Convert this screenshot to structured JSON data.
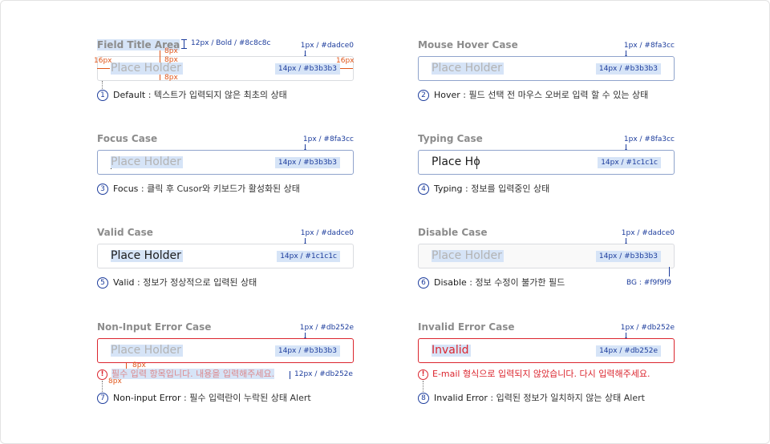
{
  "cases": [
    {
      "id": "default",
      "title": "Field Title Area",
      "value": "Place Holder",
      "spec": "14px / #b3b3b3",
      "border_note": "1px / #dadce0",
      "num": "1",
      "desc_label": "Default",
      "desc_text": " : 텍스트가 입력되지 않은 최초의 상태"
    },
    {
      "id": "hover",
      "title": "Mouse Hover Case",
      "value": "Place Holder",
      "spec": "14px / #b3b3b3",
      "border_note": "1px / #8fa3cc",
      "num": "2",
      "desc_label": "Hover",
      "desc_text": " : 필드 선택 전 마우스 오버로 입력 할 수 있는 상태"
    },
    {
      "id": "focus",
      "title": "Focus Case",
      "value": "Place Holder",
      "spec": "14px / #b3b3b3",
      "border_note": "1px / #8fa3cc",
      "num": "3",
      "desc_label": "Focus",
      "desc_text": " : 클릭 후 Cusor와 키보드가 활성화된 상태"
    },
    {
      "id": "typing",
      "title": "Typing Case",
      "value": "Place Ho",
      "spec": "14px / #1c1c1c",
      "border_note": "1px / #8fa3cc",
      "num": "4",
      "desc_label": "Typing",
      "desc_text": " : 정보를 입력중인 상태"
    },
    {
      "id": "valid",
      "title": "Valid Case",
      "value": "Place Holder",
      "spec": "14px / #1c1c1c",
      "border_note": "1px / #dadce0",
      "num": "5",
      "desc_label": "Valid",
      "desc_text": " : 정보가 정상적으로 입력된 상태"
    },
    {
      "id": "disable",
      "title": "Disable Case",
      "value": "Place Holder",
      "spec": "14px / #b3b3b3",
      "border_note": "1px / #dadce0",
      "num": "6",
      "desc_label": "Disable",
      "desc_text": " : 정보 수정이 불가한 필드",
      "bg_note": "BG : #f9f9f9"
    },
    {
      "id": "noninput",
      "title": "Non-Input Error Case",
      "value": "Place Holder",
      "spec": "14px / #b3b3b3",
      "border_note": "1px / #db252e",
      "num": "7",
      "desc_label": "Non-input Error",
      "desc_text": " : 필수 입력란이 누락된 상태 Alert",
      "alert": "필수 입력 항목입니다. 내용을 입력해주세요.",
      "alert_spec": "12px / #db252e"
    },
    {
      "id": "invalid",
      "title": "Invalid Error Case",
      "value": "Invalid",
      "spec": "14px / #db252e",
      "border_note": "1px / #db252e",
      "num": "8",
      "desc_label": "Invalid Error",
      "desc_text": " : 입력된 정보가 일치하지 않는 상태 Alert",
      "alert": "E-mail 형식으로 입력되지 않았습니다. 다시 입력해주세요."
    }
  ],
  "annotations": {
    "title_spec": "12px / Bold / #8c8c8c",
    "gap_8": "8px",
    "pad_16": "16px",
    "alert_icon": "!"
  },
  "colors": {
    "border_default": "#dadce0",
    "border_hover": "#8fa3cc",
    "border_error": "#db252e",
    "text_placeholder": "#b3b3b3",
    "text_typed": "#1c1c1c",
    "disabled_bg": "#f9f9f9",
    "annotation_blue": "#1c3c9c",
    "annotation_orange": "#e0561a"
  }
}
